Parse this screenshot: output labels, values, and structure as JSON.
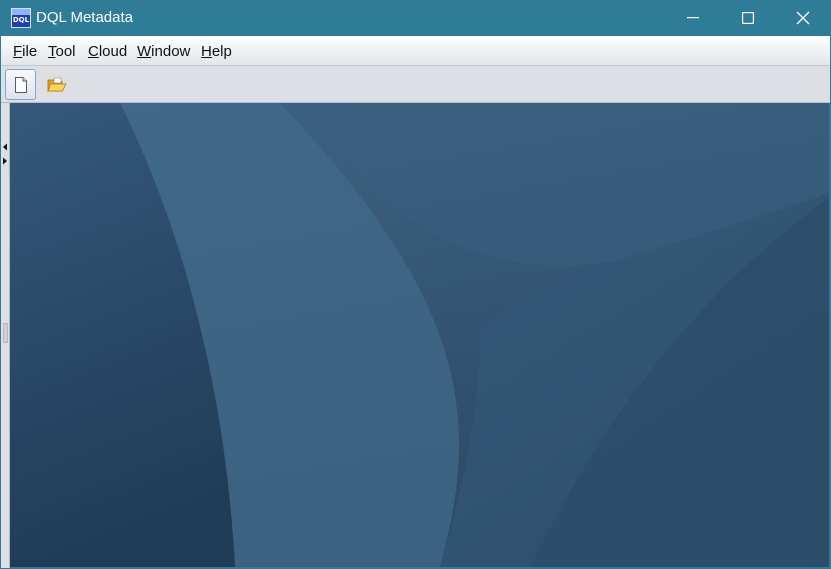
{
  "window": {
    "title": "DQL Metadata",
    "app_icon_text": "DQL",
    "colors": {
      "titlebar": "#2e7c98",
      "desktop": "#395c7a",
      "toolbar": "#dedfe4"
    }
  },
  "menubar": {
    "items": [
      {
        "mnemonic": "F",
        "rest": "ile"
      },
      {
        "mnemonic": "T",
        "rest": "ool"
      },
      {
        "mnemonic": "C",
        "rest": "loud"
      },
      {
        "mnemonic": "W",
        "rest": "indow"
      },
      {
        "mnemonic": "H",
        "rest": "elp"
      }
    ]
  },
  "toolbar": {
    "buttons": [
      {
        "icon": "new-document-icon"
      },
      {
        "icon": "open-folder-icon"
      }
    ]
  },
  "window_controls": {
    "icons": [
      "minimize-icon",
      "maximize-icon",
      "close-icon"
    ]
  }
}
